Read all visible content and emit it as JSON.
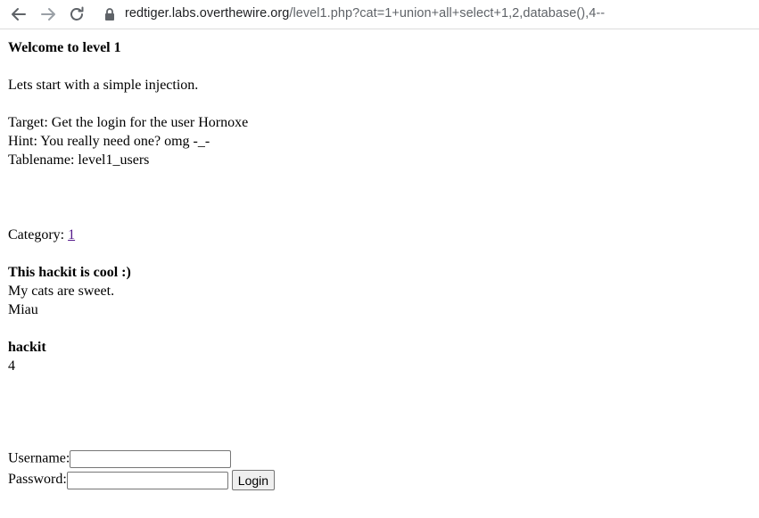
{
  "browser": {
    "url_host": "redtiger.labs.overthewire.org",
    "url_path": "/level1.php?cat=1+union+all+select+1,2,database(),4--"
  },
  "page": {
    "heading": "Welcome to level 1",
    "intro": "Lets start with a simple injection.",
    "target": "Target: Get the login for the user Hornoxe",
    "hint": "Hint: You really need one? omg -_-",
    "tablename": "Tablename: level1_users",
    "category_label": "Category: ",
    "category_link": "1",
    "article1_title": "This hackit is cool :)",
    "article1_line1": "My cats are sweet.",
    "article1_line2": "Miau",
    "article2_title": "hackit",
    "article2_value": "4"
  },
  "form": {
    "username_label": "Username:",
    "username_value": "",
    "password_label": "Password:",
    "password_value": "",
    "login_label": "Login"
  },
  "icons": {
    "back": "arrow-left-icon",
    "forward": "arrow-right-icon",
    "reload": "reload-icon",
    "lock": "lock-icon"
  }
}
